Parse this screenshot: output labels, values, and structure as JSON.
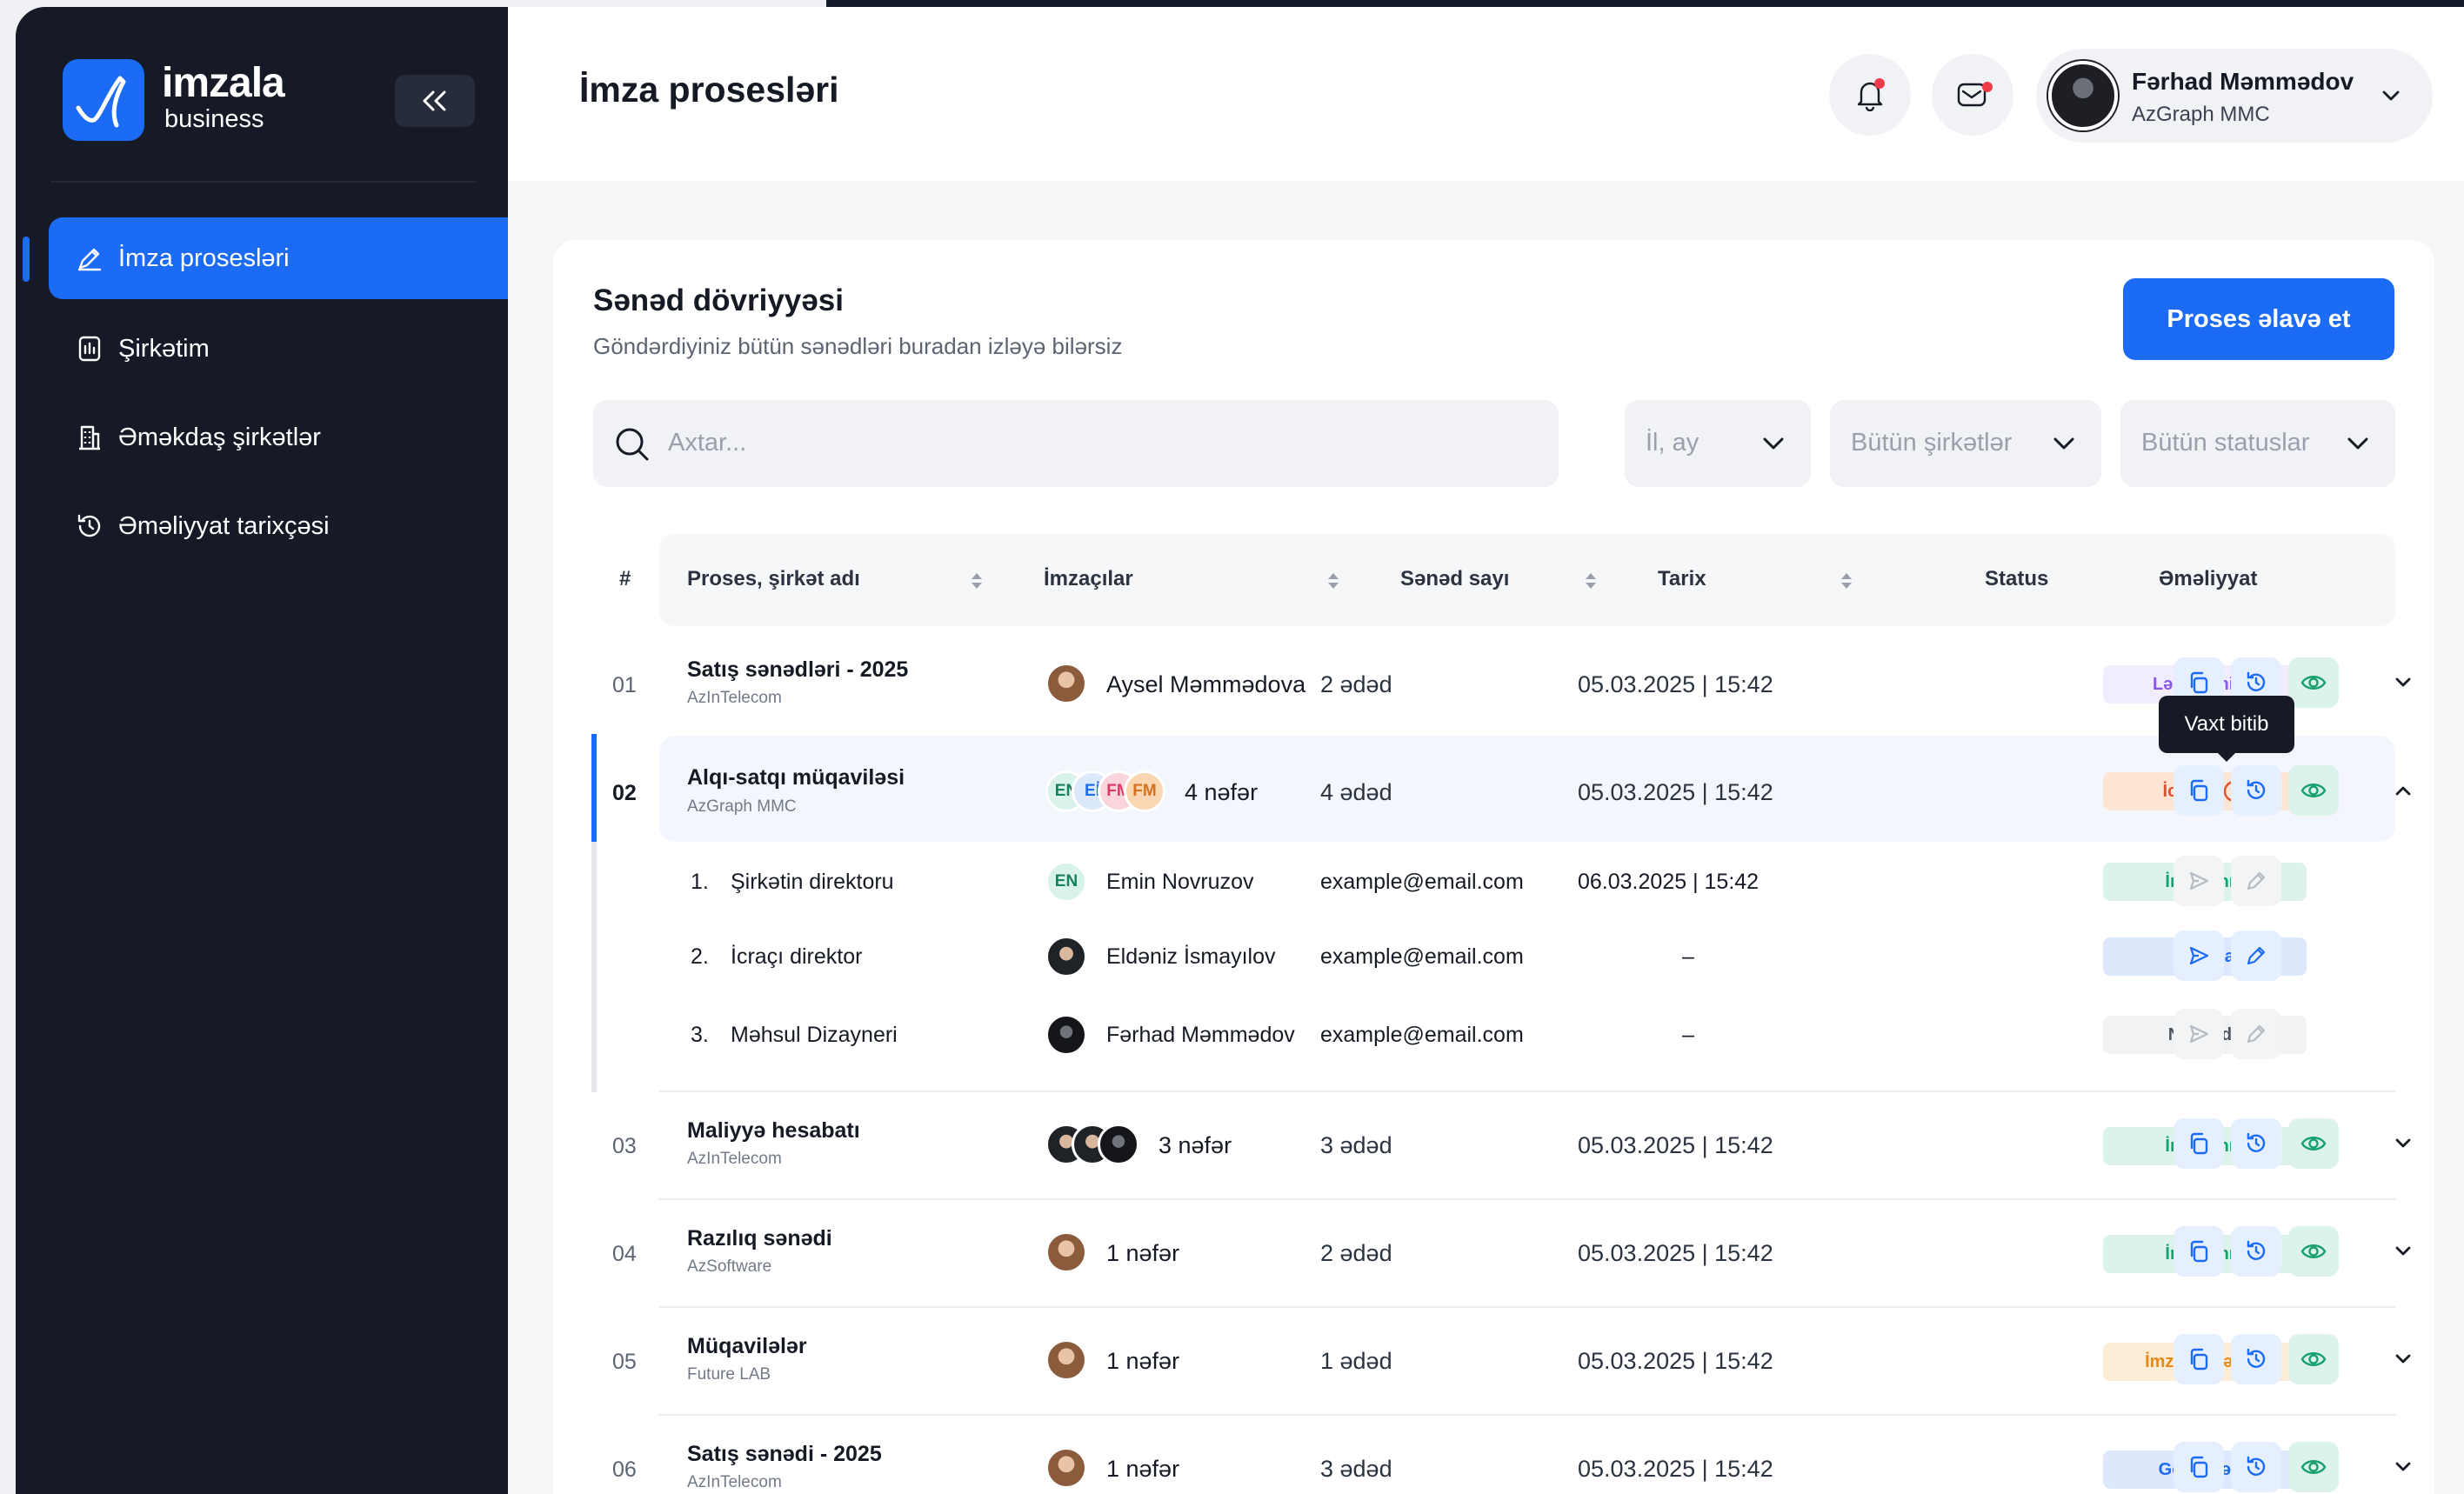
{
  "brand": {
    "name": "imzala",
    "sub": "business"
  },
  "sidebar": {
    "items": [
      {
        "label": "İmza prosesləri",
        "icon": "pen-icon"
      },
      {
        "label": "Şirkətim",
        "icon": "company-icon"
      },
      {
        "label": "Əməkdaş şirkətlər",
        "icon": "building-icon"
      },
      {
        "label": "Əməliyyat tarixçəsi",
        "icon": "history-icon"
      }
    ]
  },
  "header": {
    "title": "İmza prosesləri",
    "user_name": "Fərhad Məmmədov",
    "user_company": "AzGraph MMC"
  },
  "card": {
    "title": "Sənəd dövriyyəsi",
    "subtitle": "Göndərdiyiniz bütün sənədləri buradan izləyə bilərsiz",
    "add_button": "Proses əlavə et",
    "search_placeholder": "Axtar...",
    "filters": [
      "İl, ay",
      "Bütün şirkətlər",
      "Bütün statuslar"
    ]
  },
  "table": {
    "headers": [
      "#",
      "Proses, şirkət adı",
      "İmzaçılar",
      "Sənəd sayı",
      "Tarix",
      "Status",
      "Əməliyyat"
    ],
    "rows": [
      {
        "num": "01",
        "name": "Satış sənədləri - 2025",
        "company": "AzInTelecom",
        "signers": "Aysel Məmmədova",
        "docs": "2 ədəd",
        "date": "05.03.2025 | 15:42",
        "status": "Ləğv etmisiz"
      },
      {
        "num": "02",
        "name": "Alqı-satqı müqaviləsi",
        "company": "AzGraph MMC",
        "signers": "4 nəfər",
        "initials": [
          "EN",
          "Eİ",
          "FM",
          "FM"
        ],
        "docs": "4 ədəd",
        "date": "05.03.2025 | 15:42",
        "status": "İcrada"
      },
      {
        "num": "03",
        "name": "Maliyyə hesabatı",
        "company": "AzInTelecom",
        "signers": "3 nəfər",
        "docs": "3 ədəd",
        "date": "05.03.2025 | 15:42",
        "status": "İmzalanıb"
      },
      {
        "num": "04",
        "name": "Razılıq sənədi",
        "company": "AzSoftware",
        "signers": "1 nəfər",
        "docs": "2 ədəd",
        "date": "05.03.2025 | 15:42",
        "status": "İmzalanıb"
      },
      {
        "num": "05",
        "name": "Müqavilələr",
        "company": "Future LAB",
        "signers": "1 nəfər",
        "docs": "1 ədəd",
        "date": "05.03.2025 | 15:42",
        "status": "İmza gözlənilir"
      },
      {
        "num": "06",
        "name": "Satış sənədi - 2025",
        "company": "AzInTelecom",
        "signers": "1 nəfər",
        "docs": "3 ədəd",
        "date": "05.03.2025 | 15:42",
        "status": "Gözləmədə"
      }
    ],
    "expanded": [
      {
        "idx": "1.",
        "role": "Şirkətin direktoru",
        "initials": "EN",
        "name": "Emin Novruzov",
        "email": "example@email.com",
        "date": "06.03.2025 | 15:42",
        "status": "İmzalanıb"
      },
      {
        "idx": "2.",
        "role": "İcraçı direktor",
        "name": "Eldəniz İsmayılov",
        "email": "example@email.com",
        "date": "–",
        "status": "İmzada"
      },
      {
        "idx": "3.",
        "role": "Məhsul Dizayneri",
        "name": "Fərhad Məmmədov",
        "email": "example@email.com",
        "date": "–",
        "status": "Növbədə"
      }
    ],
    "tooltip": "Vaxt bitib"
  },
  "colors": {
    "accent": "#1c6bf5",
    "sidebar": "#151a26"
  }
}
